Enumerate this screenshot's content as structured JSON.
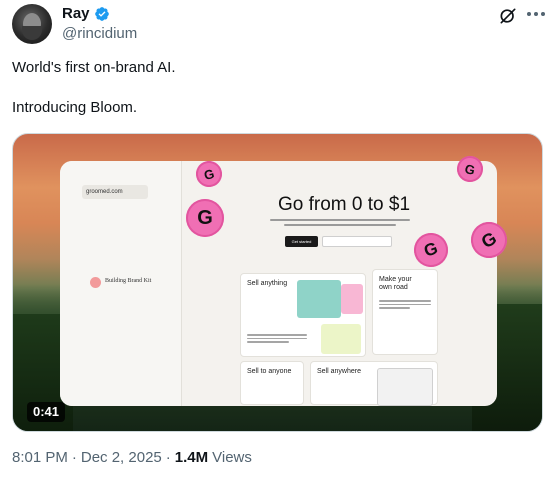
{
  "author": {
    "display_name": "Ray",
    "handle": "@rincidium",
    "verified": true,
    "avatar_icon": "profile-photo"
  },
  "tweet": {
    "lines": [
      "World's first on-brand AI.",
      "Introducing Bloom."
    ]
  },
  "media": {
    "duration": "0:41",
    "screen": {
      "sidebar_input": "groomed.com",
      "sidebar_item": "Building Brand Kit",
      "hero_title": "Go from 0 to $1",
      "hero_button": "Get started",
      "cards": {
        "sell_anything": "Sell anything",
        "own_road": "Make your own road",
        "sell_anyone": "Sell to anyone",
        "sell_anywhere": "Sell anywhere"
      },
      "coin_letter": "G"
    }
  },
  "footer": {
    "time": "8:01 PM",
    "separator": "·",
    "date": "Dec 2, 2025",
    "views_count": "1.4M",
    "views_label": "Views"
  },
  "colors": {
    "verified": "#1d9bf0",
    "coin": "#f06fb4",
    "muted": "#536471"
  }
}
